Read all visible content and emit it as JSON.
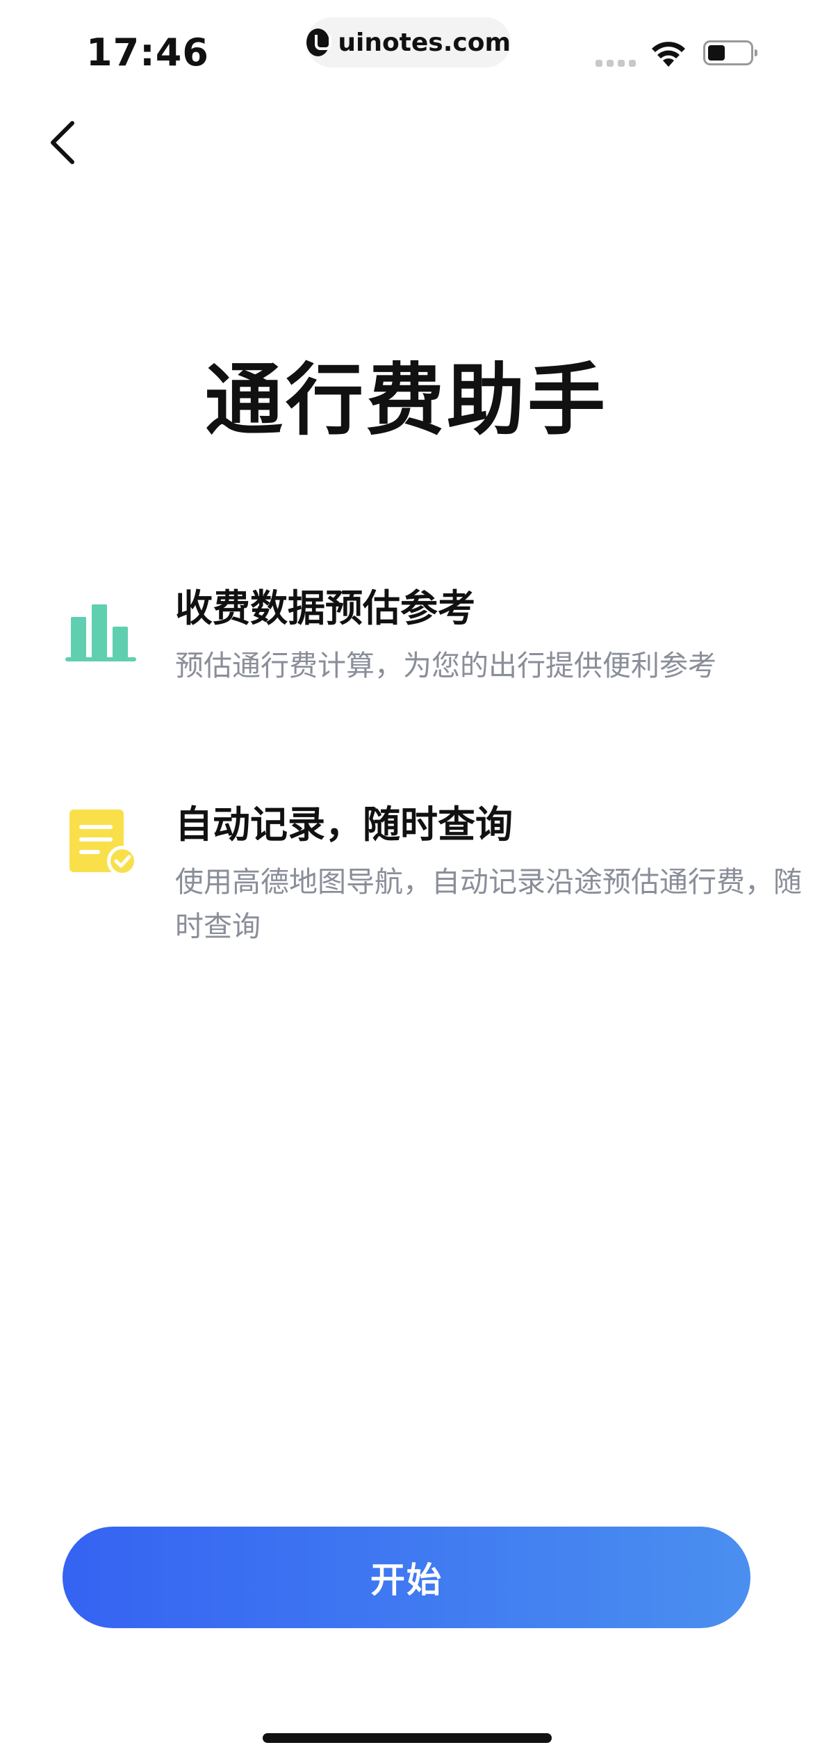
{
  "status_bar": {
    "time": "17:46",
    "url": "uinotes.com"
  },
  "header": {
    "title": "通行费助手"
  },
  "features": [
    {
      "title": "收费数据预估参考",
      "description": "预估通行费计算，为您的出行提供便利参考",
      "icon": "bar-chart-icon",
      "icon_color": "#5fcfb0"
    },
    {
      "title": "自动记录，随时查询",
      "description": "使用高德地图导航，自动记录沿途预估通行费，随时查询",
      "icon": "document-check-icon",
      "icon_color": "#f9e04a"
    }
  ],
  "actions": {
    "start_label": "开始"
  },
  "colors": {
    "button_start": "#3563f2",
    "button_end": "#4a8ff0",
    "description_text": "#8a8e99"
  }
}
